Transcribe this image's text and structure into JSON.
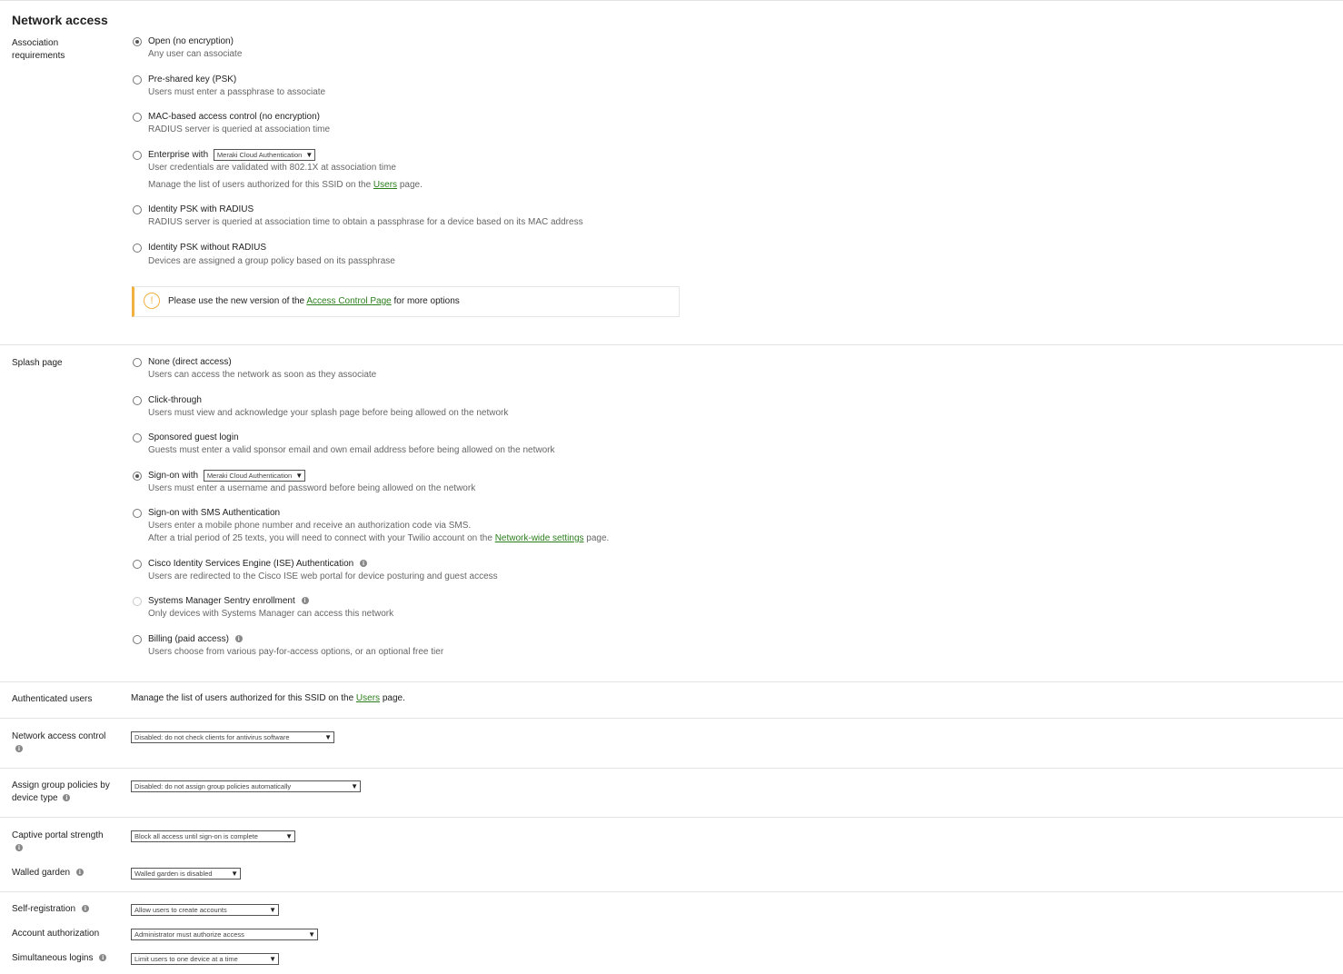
{
  "page_title": "Network access",
  "association": {
    "label": "Association requirements",
    "options": [
      {
        "title": "Open (no encryption)",
        "desc": "Any user can associate",
        "checked": true
      },
      {
        "title": "Pre-shared key (PSK)",
        "desc": "Users must enter a passphrase to associate"
      },
      {
        "title": "MAC-based access control (no encryption)",
        "desc": "RADIUS server is queried at association time"
      },
      {
        "title": "Enterprise with",
        "select": "Meraki Cloud Authentication",
        "desc": "User credentials are validated with 802.1X at association time",
        "extra_pre": "Manage the list of users authorized for this SSID on the ",
        "extra_link": "Users",
        "extra_post": " page."
      },
      {
        "title": "Identity PSK with RADIUS",
        "desc": "RADIUS server is queried at association time to obtain a passphrase for a device based on its MAC address"
      },
      {
        "title": "Identity PSK without RADIUS",
        "desc": "Devices are assigned a group policy based on its passphrase"
      }
    ],
    "notice": {
      "pre": "Please use the new version of the ",
      "link": "Access Control Page",
      "post": " for more options"
    }
  },
  "splash": {
    "label": "Splash page",
    "options": [
      {
        "title": "None (direct access)",
        "desc": "Users can access the network as soon as they associate"
      },
      {
        "title": "Click-through",
        "desc": "Users must view and acknowledge your splash page before being allowed on the network"
      },
      {
        "title": "Sponsored guest login",
        "desc": "Guests must enter a valid sponsor email and own email address before being allowed on the network"
      },
      {
        "title": "Sign-on with",
        "select": "Meraki Cloud Authentication",
        "desc": "Users must enter a username and password before being allowed on the network",
        "checked": true
      },
      {
        "title": "Sign-on with SMS Authentication",
        "desc": "Users enter a mobile phone number and receive an authorization code via SMS.",
        "desc2_pre": "After a trial period of 25 texts, you will need to connect with your Twilio account on the ",
        "desc2_link": "Network-wide settings",
        "desc2_post": " page."
      },
      {
        "title": "Cisco Identity Services Engine (ISE) Authentication",
        "desc": "Users are redirected to the Cisco ISE web portal for device posturing and guest access"
      },
      {
        "title": "Systems Manager Sentry enrollment",
        "desc": "Only devices with Systems Manager can access this network",
        "disabled": true
      },
      {
        "title": "Billing (paid access)",
        "desc": "Users choose from various pay-for-access options, or an optional free tier"
      }
    ]
  },
  "authenticated_users": {
    "label": "Authenticated users",
    "pre": "Manage the list of users authorized for this SSID on the ",
    "link": "Users",
    "post": " page."
  },
  "settings": {
    "network_access_control": {
      "label": "Network access control",
      "value": "Disabled: do not check clients for antivirus software"
    },
    "assign_group_policies": {
      "label": "Assign group policies by device type",
      "value": "Disabled: do not assign group policies automatically"
    },
    "captive_portal_strength": {
      "label": "Captive portal strength",
      "value": "Block all access until sign-on is complete"
    },
    "walled_garden": {
      "label": "Walled garden",
      "value": "Walled garden is disabled"
    },
    "self_registration": {
      "label": "Self-registration",
      "value": "Allow users to create accounts"
    },
    "account_authorization": {
      "label": "Account authorization",
      "value": "Administrator must authorize access"
    },
    "simultaneous_logins": {
      "label": "Simultaneous logins",
      "value": "Limit users to one device at a time"
    }
  },
  "icons": {
    "info": "info-icon",
    "warning": "warning-icon",
    "dropdown": "chevron-down-icon"
  }
}
